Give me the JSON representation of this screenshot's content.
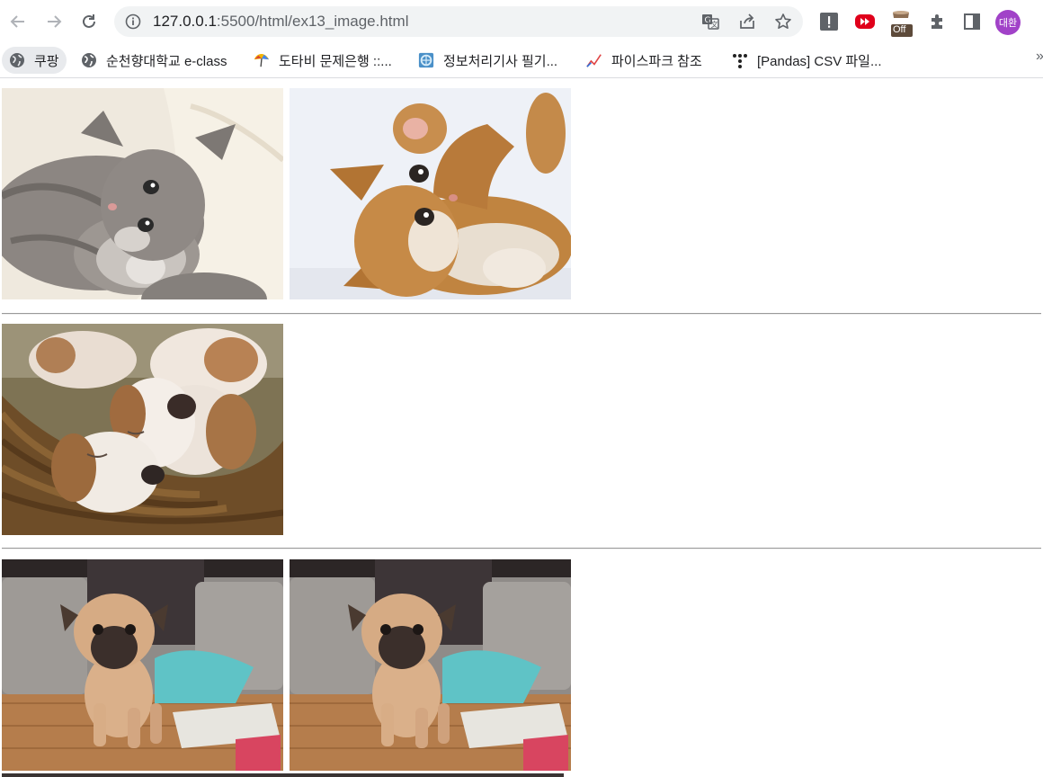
{
  "browser": {
    "url_host": "127.0.0.1",
    "url_path": ":5500/html/ex13_image.html",
    "profile_initials": "대환",
    "extension_off_badge": "Off"
  },
  "bookmarks": [
    {
      "label": "쿠팡",
      "icon": "globe-icon"
    },
    {
      "label": "순천향대학교 e-class",
      "icon": "globe-icon"
    },
    {
      "label": "도타비 문제은행 ::...",
      "icon": "umbrella-icon"
    },
    {
      "label": "정보처리기사 필기...",
      "icon": "site-icon"
    },
    {
      "label": "파이스파크 참조",
      "icon": "chart-icon"
    },
    {
      "label": "[Pandas] CSV 파일...",
      "icon": "dots-icon"
    }
  ],
  "bookmarks_overflow": "»",
  "page": {
    "images": [
      {
        "subject": "gray kitten",
        "row": 1
      },
      {
        "subject": "orange kitten",
        "row": 1
      },
      {
        "subject": "puppies in basket",
        "row": 2
      },
      {
        "subject": "pug puppy",
        "row": 3
      },
      {
        "subject": "pug puppy",
        "row": 3
      }
    ]
  }
}
